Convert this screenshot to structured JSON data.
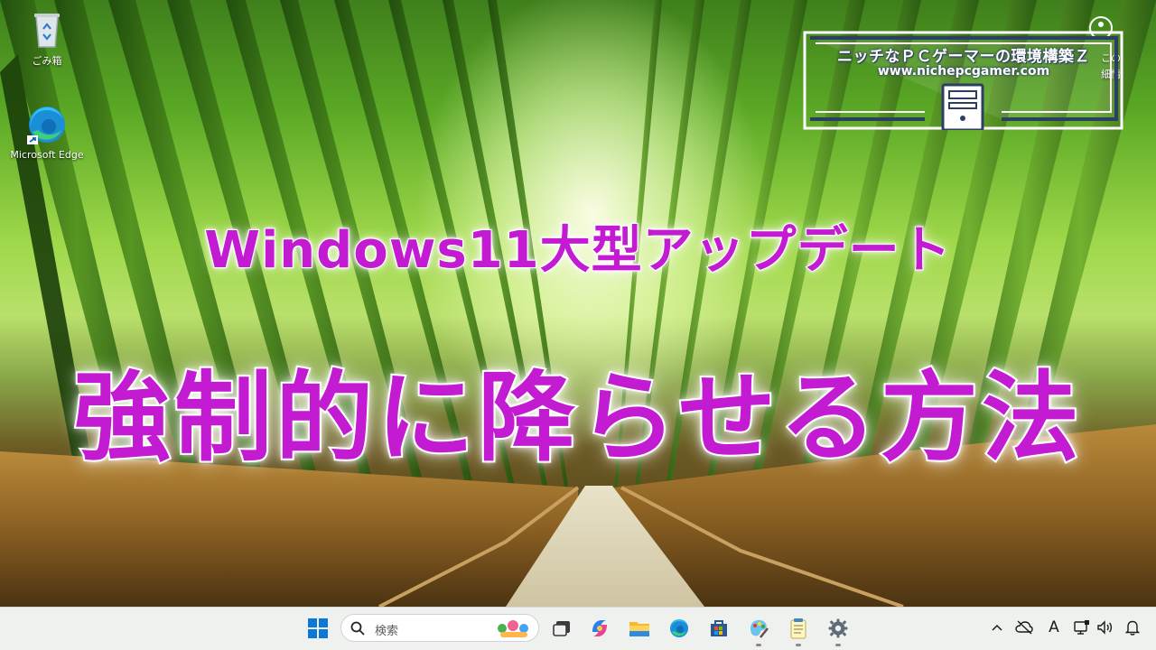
{
  "desktop": {
    "icons": [
      {
        "label": "ごみ箱",
        "icon": "recycle-bin-icon"
      },
      {
        "label": "Microsoft Edge",
        "icon": "edge-icon"
      }
    ],
    "corner_label_top": "この",
    "corner_label_bottom": "細情"
  },
  "logo": {
    "title": "ニッチなＰＣゲーマーの環境構築Ｚ",
    "url": "www.nichepcgamer.com",
    "frame_color": "#2c3e62"
  },
  "overlay": {
    "subtitle": "Windows11大型アップデート",
    "title": "強制的に降らせる方法",
    "text_color": "#c21bd2",
    "outline_color": "#ffffff"
  },
  "taskbar": {
    "search_placeholder": "検索",
    "apps": [
      "start-icon",
      "task-view-icon",
      "copilot-icon",
      "file-explorer-icon",
      "edge-icon",
      "store-icon",
      "paint-icon",
      "notepad-icon",
      "settings-icon"
    ],
    "tray": {
      "chevron": "^",
      "ime": "A"
    }
  }
}
